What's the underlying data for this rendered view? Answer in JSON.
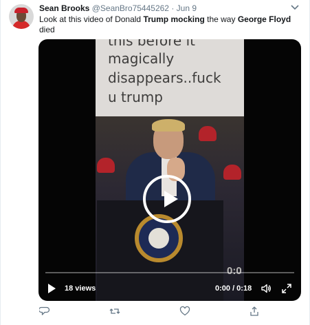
{
  "tweet": {
    "author_name": "Sean Brooks",
    "author_handle": "@SeanBro75445262",
    "separator": " · ",
    "date": "Jun 9",
    "text_parts": [
      {
        "text": "Look at this video of Donald ",
        "bold": false
      },
      {
        "text": "Trump mocking",
        "bold": true
      },
      {
        "text": " the way ",
        "bold": false
      },
      {
        "text": "George Floyd",
        "bold": true
      },
      {
        "text": " died",
        "bold": false
      }
    ]
  },
  "video": {
    "caption_lines": [
      "this before it",
      "magically",
      "disappears..fuck",
      "u trump"
    ],
    "frame_counter": "0:0",
    "views": "18 views",
    "time": "0:00 / 0:18",
    "progress": 0
  },
  "icons": {
    "caret": "chevron-down-icon",
    "play_overlay": "play-icon",
    "play_control": "play-icon",
    "volume": "volume-icon",
    "fullscreen": "fullscreen-icon",
    "reply": "reply-icon",
    "retweet": "retweet-icon",
    "like": "heart-icon",
    "share": "share-icon"
  },
  "colors": {
    "text": "#14171a",
    "muted": "#657786",
    "video_bg": "#050505",
    "seal_gold": "#b98a2e"
  }
}
